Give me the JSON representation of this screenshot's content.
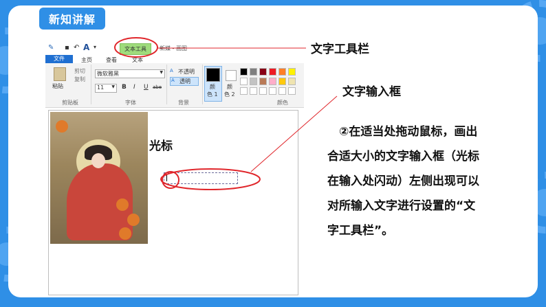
{
  "badge": {
    "title": "新知讲解"
  },
  "app": {
    "quick_access": "▾",
    "context_tab": "文本工具",
    "window_title": "新媒 - 画图",
    "ribbon_tabs": [
      "文件",
      "主页",
      "查看",
      "文本"
    ],
    "clipboard": {
      "paste": "粘贴",
      "cut": "剪切",
      "copy": "复制",
      "group": "剪贴板"
    },
    "font": {
      "name": "微软雅黑",
      "size": "11",
      "bold": "B",
      "italic": "I",
      "underline": "U",
      "strike": "abe",
      "group": "字体"
    },
    "background": {
      "opaque": "不透明",
      "transparent": "透明",
      "group": "背景"
    },
    "colors": {
      "color1_line1": "颜",
      "color1_line2": "色 1",
      "color2_line1": "颜",
      "color2_line2": "色 2",
      "group": "颜色",
      "color1_value": "#000000",
      "color2_value": "#ffffff",
      "palette": [
        "#000000",
        "#7f7f7f",
        "#880015",
        "#ed1c24",
        "#ff7f27",
        "#fff200",
        "#ffffff",
        "#c3c3c3",
        "#b97a57",
        "#ffaec9",
        "#ffc90e",
        "#efe4b0"
      ]
    }
  },
  "annotations": {
    "toolbar_label": "文字工具栏",
    "input_box_label": "文字输入框",
    "cursor_label": "光标"
  },
  "body_lines": [
    "　②在适当处拖动鼠标，画出",
    "合适大小的文字输入框（光标",
    "在输入处闪动）左侧出现可以",
    "对所输入文字进行设置的“文",
    "字工具栏”。"
  ],
  "colors": {
    "accent": "#2f8fe6",
    "annotation_red": "#e0262b",
    "context_green": "#9fdc7c"
  }
}
